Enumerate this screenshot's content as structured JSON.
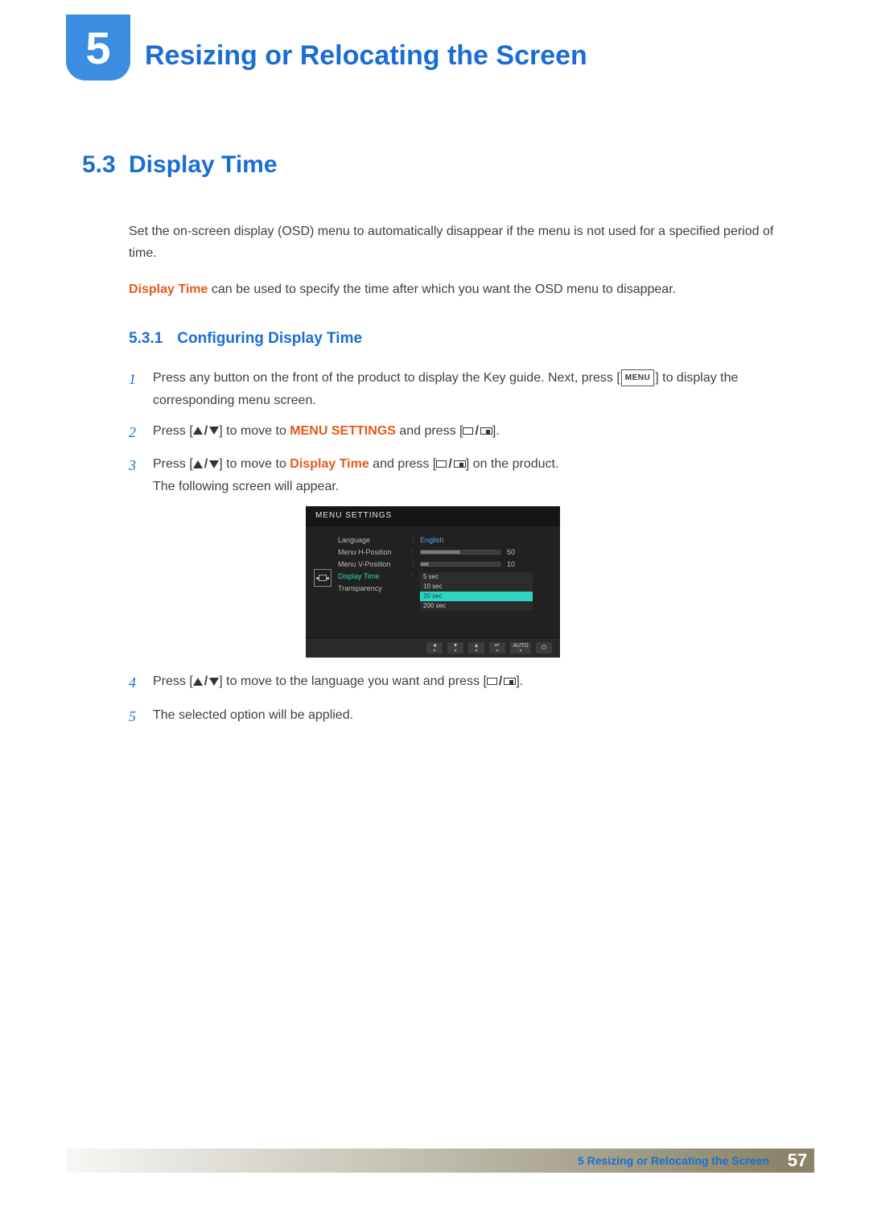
{
  "chapter": {
    "number": "5",
    "title": "Resizing or Relocating the Screen"
  },
  "section": {
    "number": "5.3",
    "title": "Display Time",
    "intro": "Set the on-screen display (OSD) menu to automatically disappear if the menu is not used for a specified period of time.",
    "highlight_term": "Display Time",
    "highlight_rest": " can be used to specify the time after which you want the OSD menu to disappear."
  },
  "subsection": {
    "number": "5.3.1",
    "title": "Configuring Display Time"
  },
  "steps": {
    "s1": {
      "num": "1",
      "a": "Press any button on the front of the product to display the Key guide. Next, press [",
      "menu_chip": "MENU",
      "b": "] to display the corresponding menu screen."
    },
    "s2": {
      "num": "2",
      "a": "Press [",
      "b": "] to move to ",
      "target": "MENU SETTINGS",
      "c": " and press [",
      "d": "]."
    },
    "s3": {
      "num": "3",
      "a": "Press [",
      "b": "] to move to ",
      "target": "Display Time",
      "c": " and press [",
      "d": "] on the product.",
      "follow": "The following screen will appear."
    },
    "s4": {
      "num": "4",
      "a": "Press [",
      "b": "] to move to the language you want and press [",
      "c": "]."
    },
    "s5": {
      "num": "5",
      "text": "The selected option will be applied."
    }
  },
  "osd": {
    "title": "MENU SETTINGS",
    "rows": {
      "language": {
        "label": "Language",
        "value": "English"
      },
      "hpos": {
        "label": "Menu H-Position",
        "value": "50",
        "fill": 50
      },
      "vpos": {
        "label": "Menu V-Position",
        "value": "10",
        "fill": 10
      },
      "display": {
        "label": "Display Time"
      },
      "trans": {
        "label": "Transparency"
      }
    },
    "options": [
      "5 sec",
      "10 sec",
      "20 sec",
      "200 sec"
    ],
    "selected_option": "20 sec",
    "footer": {
      "auto": "AUTO"
    }
  },
  "footer": {
    "label": "5 Resizing or Relocating the Screen",
    "page": "57"
  }
}
